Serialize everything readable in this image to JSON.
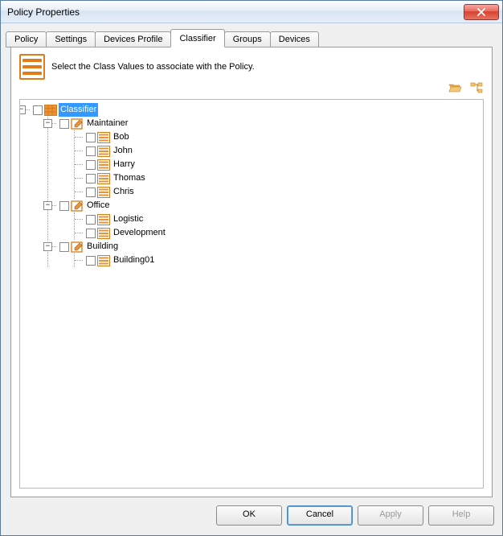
{
  "window": {
    "title": "Policy Properties"
  },
  "tabs": [
    {
      "label": "Policy"
    },
    {
      "label": "Settings"
    },
    {
      "label": "Devices Profile"
    },
    {
      "label": "Classifier",
      "active": true
    },
    {
      "label": "Groups"
    },
    {
      "label": "Devices"
    }
  ],
  "header": {
    "text": "Select the Class Values to associate with the Policy."
  },
  "tree": {
    "root_label": "Classifier",
    "groups": [
      {
        "label": "Maintainer",
        "items": [
          {
            "label": "Bob"
          },
          {
            "label": "John"
          },
          {
            "label": "Harry"
          },
          {
            "label": "Thomas"
          },
          {
            "label": "Chris"
          }
        ]
      },
      {
        "label": "Office",
        "items": [
          {
            "label": "Logistic"
          },
          {
            "label": "Development"
          }
        ]
      },
      {
        "label": "Building",
        "items": [
          {
            "label": "Building01"
          }
        ]
      }
    ]
  },
  "buttons": {
    "ok": "OK",
    "cancel": "Cancel",
    "apply": "Apply",
    "help": "Help"
  }
}
